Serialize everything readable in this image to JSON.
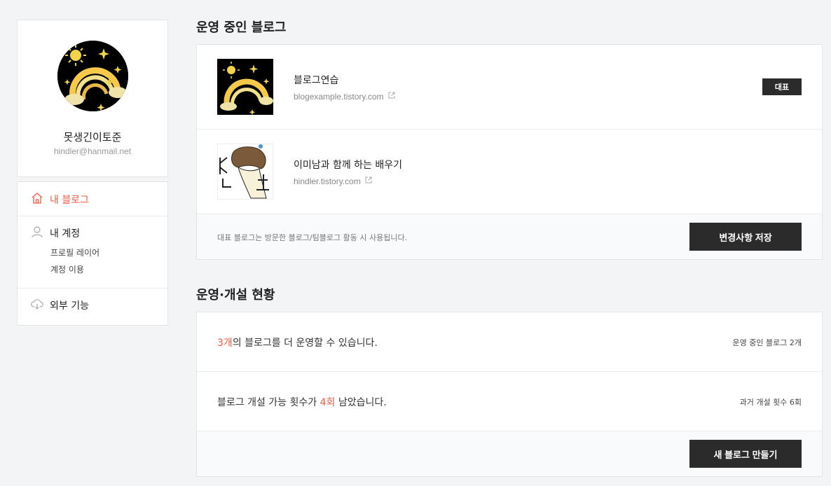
{
  "profile": {
    "name": "못생긴이토준",
    "email": "hindler@hanmail.net"
  },
  "nav": {
    "my_blog": "내 블로그",
    "my_account": "내 계정",
    "account_sub": [
      "프로필 레이어",
      "계정 이용"
    ],
    "external": "외부 기능"
  },
  "operating": {
    "title": "운영 중인 블로그",
    "blogs": [
      {
        "name": "블로그연습",
        "url": "blogexample.tistory.com",
        "badge": "대표"
      },
      {
        "name": "이미남과 함께 하는 배우기",
        "url": "hindler.tistory.com"
      }
    ],
    "footnote": "대표 블로그는 방문한 블로그/팀블로그 활동 시 사용됩니다.",
    "save_button": "변경사항 저장"
  },
  "status": {
    "title": "운영·개설 현황",
    "row1": {
      "hl": "3개",
      "text": "의 블로그를 더 운영할 수 있습니다.",
      "right": "운영 중인 블로그 2개"
    },
    "row2": {
      "pre": "블로그 개설 가능 횟수가 ",
      "hl": "4회",
      "post": " 남았습니다.",
      "right": "과거 개설 횟수 6회"
    },
    "create_button": "새 블로그 만들기"
  },
  "colors": {
    "accent": "#f05b43",
    "dark": "#2b2b2b"
  }
}
